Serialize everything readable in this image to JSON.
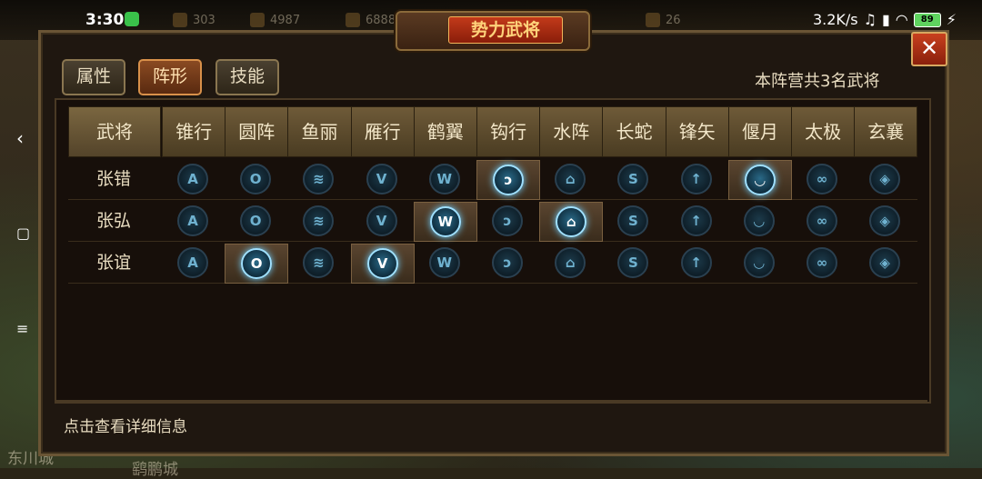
{
  "status_bar": {
    "time": "3:30",
    "net_speed": "3.2K/s",
    "battery": "89"
  },
  "resources": [
    "303",
    "4987",
    "6888",
    "26"
  ],
  "map_labels": [
    "东川城",
    "鹞鹏城"
  ],
  "title": "势力武将",
  "tabs": [
    "属性",
    "阵形",
    "技能"
  ],
  "active_tab": "阵形",
  "summary": "本阵营共3名武将",
  "table": {
    "corner": "武将",
    "columns": [
      "锥行",
      "圆阵",
      "鱼丽",
      "雁行",
      "鹤翼",
      "钩行",
      "水阵",
      "长蛇",
      "锋矢",
      "偃月",
      "太极",
      "玄襄"
    ],
    "icons": [
      "A",
      "O",
      "≋",
      "V",
      "W",
      "ↄ",
      "⌂",
      "S",
      "↑",
      "◡",
      "∞",
      "◈"
    ],
    "rows": [
      {
        "name": "张错",
        "active": [
          5,
          9
        ]
      },
      {
        "name": "张弘",
        "active": [
          4,
          6
        ]
      },
      {
        "name": "张谊",
        "active": [
          1,
          3
        ]
      }
    ]
  },
  "hint": "点击查看详细信息",
  "close_label": "✕"
}
